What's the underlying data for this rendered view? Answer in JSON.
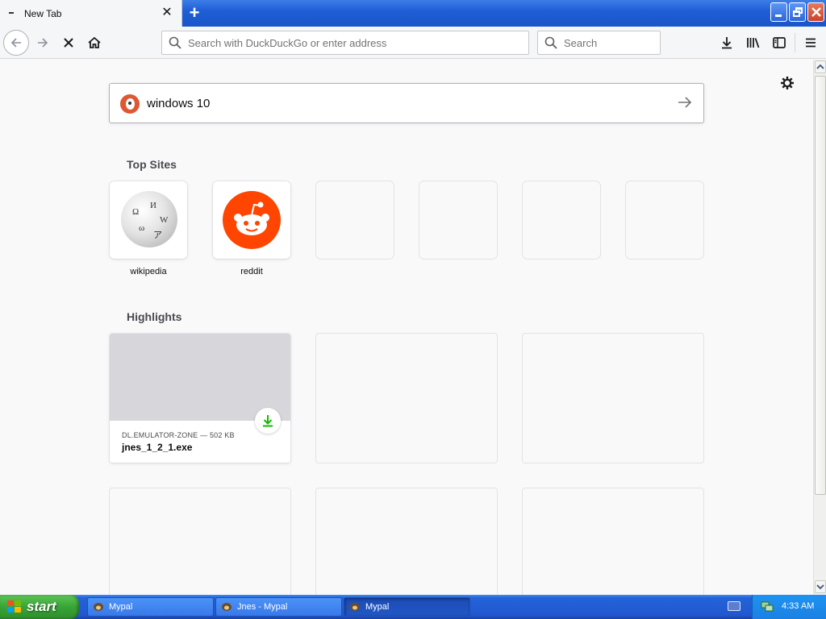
{
  "browser": {
    "tab": {
      "title": "New Tab",
      "close_label": "✕"
    },
    "new_tab_label": "+",
    "urlbar": {
      "placeholder": "Search with DuckDuckGo or enter address"
    },
    "searchbar": {
      "placeholder": "Search"
    }
  },
  "newtab": {
    "search": {
      "query": "windows 10"
    },
    "top_sites": {
      "title": "Top Sites",
      "items": [
        {
          "label": "wikipedia"
        },
        {
          "label": "reddit"
        }
      ]
    },
    "highlights": {
      "title": "Highlights",
      "items": [
        {
          "meta": "DL.EMULATOR-ZONE — 502 KB",
          "filename": "jnes_1_2_1.exe"
        }
      ]
    }
  },
  "taskbar": {
    "start_label": "start",
    "tasks": [
      {
        "label": "Mypal"
      },
      {
        "label": "Jnes - Mypal"
      },
      {
        "label": "Mypal"
      }
    ],
    "clock": "4:33 AM"
  },
  "colors": {
    "accent_download": "#12bc00",
    "reddit": "#ff4500",
    "duckduckgo": "#de5833",
    "xp_blue": "#2157d0",
    "xp_green": "#38a436"
  }
}
